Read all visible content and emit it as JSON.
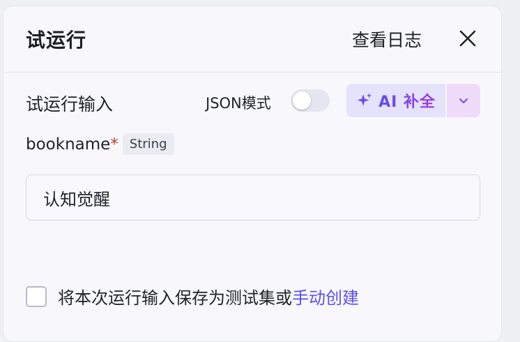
{
  "panel": {
    "title": "试运行",
    "view_log_label": "查看日志",
    "close_icon": "close-icon"
  },
  "input_section": {
    "label": "试运行输入",
    "json_mode_label": "JSON模式",
    "json_mode_enabled": false,
    "ai_button_label": "AI 补全",
    "ai_icon": "sparkle-icon",
    "ai_dropdown_icon": "chevron-down-icon"
  },
  "field": {
    "name": "bookname",
    "required_marker": "*",
    "type": "String",
    "value": "认知觉醒"
  },
  "save": {
    "checked": false,
    "text": "将本次运行输入保存为测试集或",
    "link": "手动创建"
  },
  "colors": {
    "accent": "#5b4ef0",
    "accent_gradient_end": "#a338e6",
    "required": "#c0392b"
  }
}
